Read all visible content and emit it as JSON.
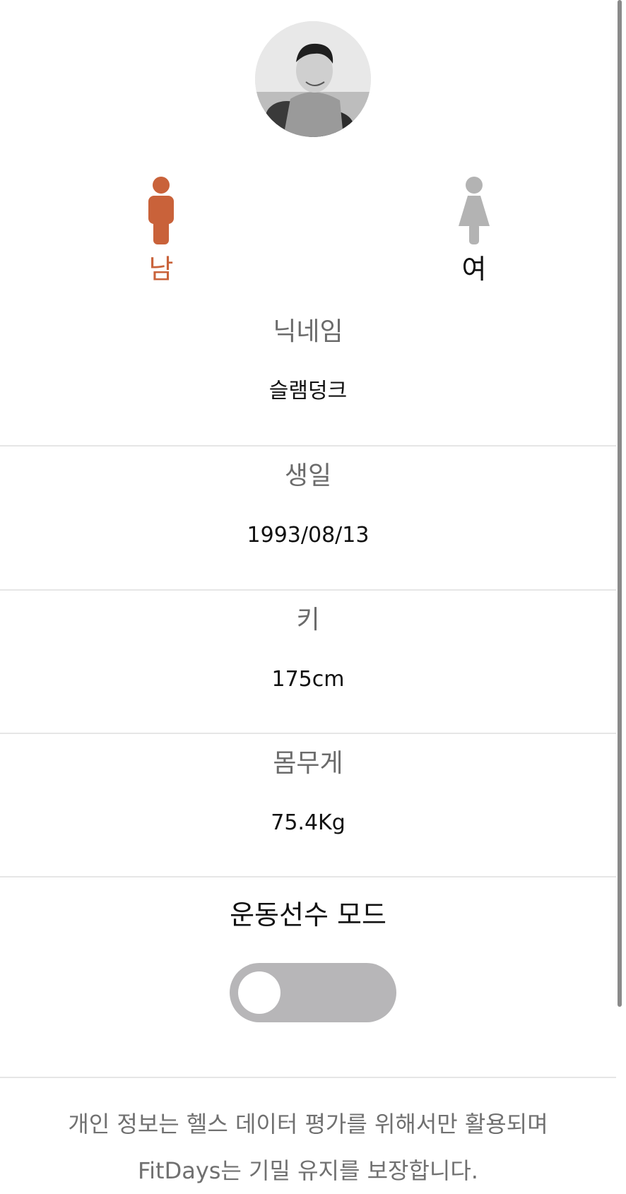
{
  "profile": {
    "avatar_icon": "profile-photo"
  },
  "gender": {
    "male": {
      "label": "남",
      "selected": true,
      "color": "#c9623a"
    },
    "female": {
      "label": "여",
      "selected": false,
      "color": "#b3b3b3"
    }
  },
  "fields": {
    "nickname": {
      "title": "닉네임",
      "value": "슬램덩크"
    },
    "birthday": {
      "title": "생일",
      "value": "1993/08/13"
    },
    "height": {
      "title": "키",
      "value": "175cm"
    },
    "weight": {
      "title": "몸무게",
      "value": "75.4Kg"
    }
  },
  "athlete_mode": {
    "title": "운동선수 모드",
    "enabled": false,
    "track_color": "#b7b6b8"
  },
  "footer": {
    "line1": "개인 정보는 헬스 데이터 평가를 위해서만 활용되며",
    "line2": "FitDays는 기밀 유지를 보장합니다."
  }
}
